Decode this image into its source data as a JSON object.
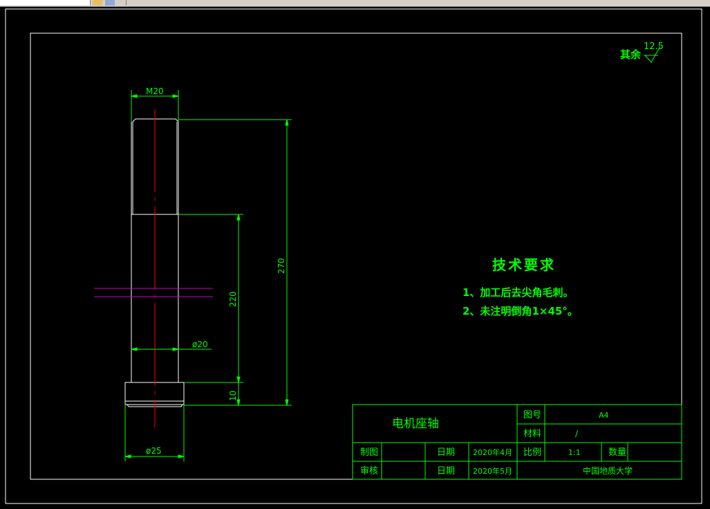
{
  "roughness": {
    "label": "其余",
    "value": "12.5"
  },
  "dimensions": {
    "thread": "M20",
    "total_length": "270",
    "shaft_length": "220",
    "shaft_diameter": "ø20",
    "head_height": "10",
    "head_diameter": "ø25"
  },
  "technical_requirements": {
    "title": "技术要求",
    "items": [
      "1、加工后去尖角毛刺。",
      "2、未注明倒角1×45°。"
    ]
  },
  "title_block": {
    "part_name": "电机座轴",
    "drawing_no_label": "图号",
    "drawing_no": "A4",
    "material_label": "材料",
    "material": "/",
    "drawn_label": "制图",
    "drawn_value": "",
    "date_label_1": "日期",
    "date_1": "2020年4月",
    "scale_label": "比例",
    "scale": "1:1",
    "qty_label": "数量",
    "qty": "",
    "checked_label": "审核",
    "checked_value": "",
    "date_label_2": "日期",
    "date_2": "2020年5月",
    "organization": "中国地质大学"
  },
  "colors": {
    "background": "#000000",
    "geometry": "#ffffff",
    "dimension": "#00ff00",
    "centerline": "#ff0000",
    "section": "#cc00cc"
  }
}
